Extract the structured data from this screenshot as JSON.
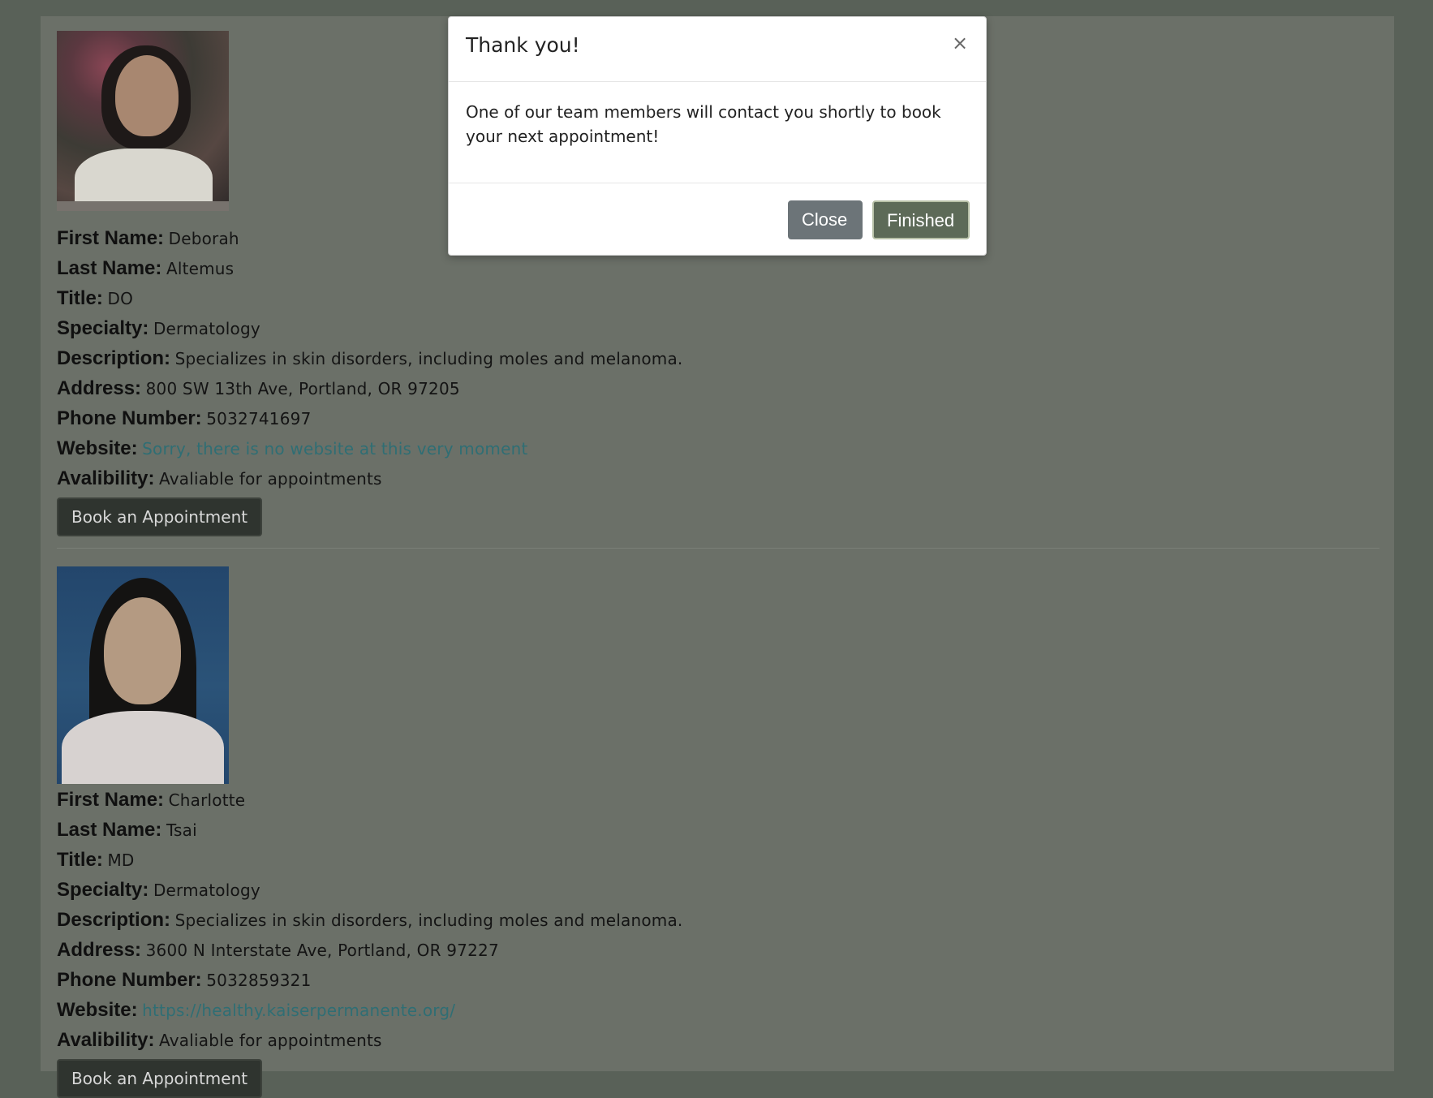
{
  "modal": {
    "title": "Thank you!",
    "close_icon": "×",
    "message": "One of our team members will contact you shortly to book your next appointment!",
    "close_label": "Close",
    "finished_label": "Finished"
  },
  "labels": {
    "first_name": "First Name:",
    "last_name": "Last Name:",
    "title": "Title:",
    "specialty": "Specialty:",
    "description": "Description:",
    "address": "Address:",
    "phone": "Phone Number:",
    "website": "Website:",
    "availability": "Avalibility:"
  },
  "doctors": [
    {
      "first_name": "Deborah",
      "last_name": "Altemus",
      "title": "DO",
      "specialty": "Dermatology",
      "description": "Specializes in skin disorders, including moles and melanoma.",
      "address": "800 SW 13th Ave, Portland, OR 97205",
      "phone": "5032741697",
      "website": "Sorry, there is no website at this very moment",
      "availability": "Avaliable for appointments",
      "book_label": "Book an Appointment"
    },
    {
      "first_name": "Charlotte",
      "last_name": "Tsai",
      "title": "MD",
      "specialty": "Dermatology",
      "description": "Specializes in skin disorders, including moles and melanoma.",
      "address": "3600 N Interstate Ave, Portland, OR 97227",
      "phone": "5032859321",
      "website": "https://healthy.kaiserpermanente.org/",
      "availability": "Avaliable for appointments",
      "book_label": "Book an Appointment"
    }
  ]
}
